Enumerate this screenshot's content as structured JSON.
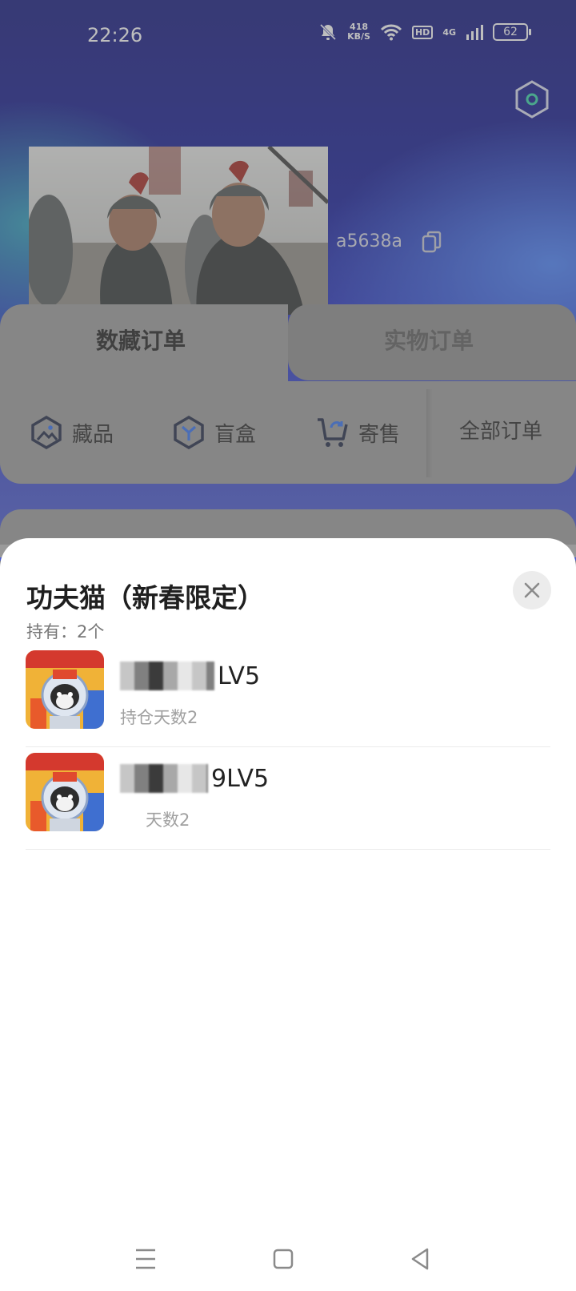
{
  "status_bar": {
    "time": "22:26",
    "speed_value": "418",
    "speed_unit": "KB/S",
    "hd": "HD",
    "network": "4G",
    "battery": "62"
  },
  "profile": {
    "id_suffix": "a5638a"
  },
  "tabs": {
    "digital_orders": "数藏订单",
    "physical_orders": "实物订单"
  },
  "order_types": {
    "collectibles": "藏品",
    "blind_box": "盲盒",
    "consignment": "寄售",
    "all_orders": "全部订单"
  },
  "sheet": {
    "title": "功夫猫（新春限定）",
    "holding": "持有：2个",
    "rows": [
      {
        "level": "LV5",
        "days": "持仓天数2"
      },
      {
        "level": "9LV5",
        "days": "天数2"
      }
    ]
  },
  "colors": {
    "header_gradient_top": "#0a0f7a",
    "header_gradient_bottom": "#4b5bd0",
    "sheet_bg": "#ffffff"
  },
  "icons": [
    "bell-muted-icon",
    "wifi-icon",
    "signal-icon",
    "battery-icon",
    "settings-hexagon-icon",
    "copy-icon",
    "collectible-icon",
    "blind-box-icon",
    "cart-icon",
    "close-icon",
    "menu-icon",
    "home-icon",
    "back-icon"
  ]
}
